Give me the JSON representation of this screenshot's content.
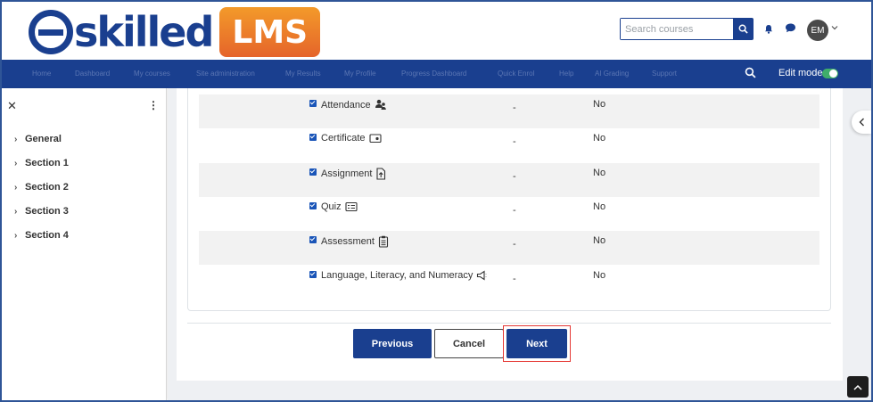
{
  "brand": {
    "logo_word": "skilled",
    "logo_badge": "LMS"
  },
  "header": {
    "search_placeholder": "Search courses",
    "avatar_initials": "EM"
  },
  "nav": {
    "items": [
      "Home",
      "Dashboard",
      "My courses",
      "Site administration",
      "My Results",
      "My Profile",
      "Progress Dashboard",
      "Quick Enrol",
      "Help",
      "AI Grading",
      "Support"
    ],
    "edit_mode_label": "Edit mode",
    "edit_mode_on": true
  },
  "sidebar": {
    "items": [
      {
        "label": "General"
      },
      {
        "label": "Section 1"
      },
      {
        "label": "Section 2"
      },
      {
        "label": "Section 3"
      },
      {
        "label": "Section 4"
      }
    ]
  },
  "activities": [
    {
      "name": "Attendance",
      "icon": "attendance-icon",
      "dash": "-",
      "value": "No",
      "checked": true
    },
    {
      "name": "Certificate",
      "icon": "certificate-icon",
      "dash": "-",
      "value": "No",
      "checked": true
    },
    {
      "name": "Assignment",
      "icon": "assignment-icon",
      "dash": "-",
      "value": "No",
      "checked": true
    },
    {
      "name": "Quiz",
      "icon": "quiz-icon",
      "dash": "-",
      "value": "No",
      "checked": true
    },
    {
      "name": "Assessment",
      "icon": "assessment-icon",
      "dash": "-",
      "value": "No",
      "checked": true
    },
    {
      "name": "Language, Literacy, and Numeracy",
      "icon": "megaphone-icon",
      "dash": "-",
      "value": "No",
      "checked": true
    }
  ],
  "buttons": {
    "previous": "Previous",
    "cancel": "Cancel",
    "next": "Next"
  },
  "colors": {
    "brand_blue": "#1a3f8f",
    "highlight": "#e53935",
    "toggle_on": "#3fae6a"
  }
}
